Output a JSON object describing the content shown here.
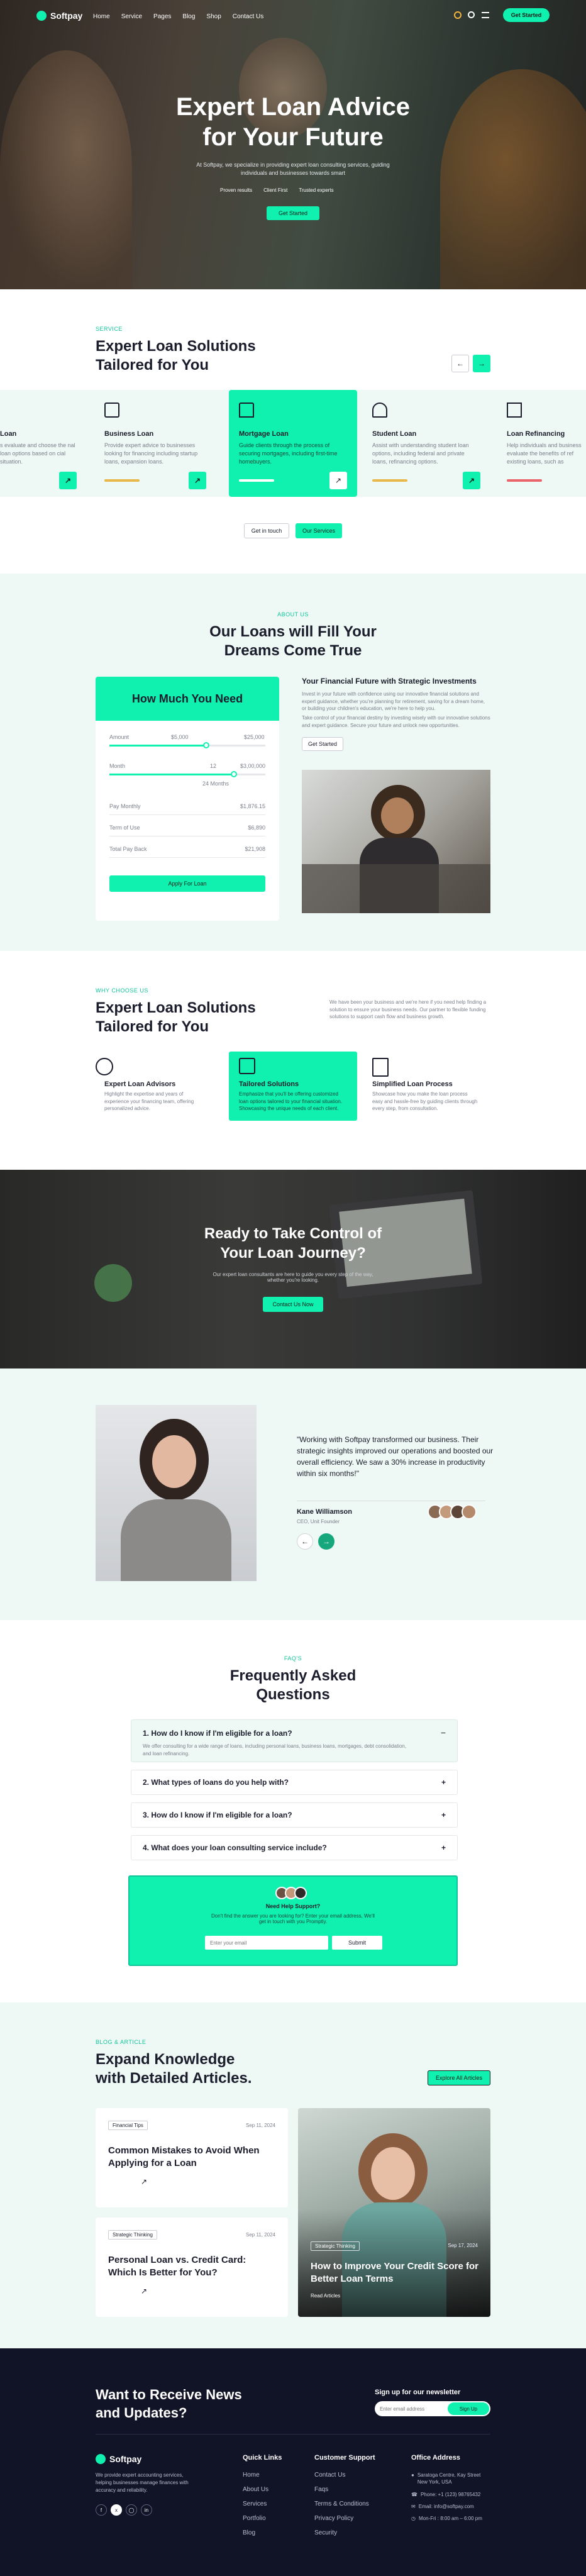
{
  "nav": {
    "brand": "Softpay",
    "items": [
      "Home",
      "Service",
      "Pages",
      "Blog",
      "Shop",
      "Contact Us"
    ],
    "cta": "Get Started"
  },
  "hero": {
    "title_line1": "Expert Loan Advice",
    "title_line2": "for Your Future",
    "subtitle": "At Softpay, we specialize in providing expert loan consulting services, guiding individuals and businesses towards smart",
    "badges": [
      "Proven results",
      "Client First",
      "Trusted experts"
    ],
    "cta": "Get Started"
  },
  "services": {
    "eyebrow": "SERVICE",
    "title_line1": "Expert Loan Solutions",
    "title_line2": "Tailored for You",
    "cards": [
      {
        "title": "Loan",
        "desc": "s evaluate and choose the nal loan options based on cial situation.",
        "variant": "partial-left"
      },
      {
        "title": "Business Loan",
        "desc": "Provide expert advice to businesses looking for financing including startup loans, expansion loans.",
        "variant": "normal"
      },
      {
        "title": "Mortgage Loan",
        "desc": "Guide clients through the process of securing mortgages, including first-time homebuyers.",
        "variant": "active"
      },
      {
        "title": "Student Loan",
        "desc": "Assist with understanding student loan options, including federal and private loans, refinancing options.",
        "variant": "normal"
      },
      {
        "title": "Loan Refinancing",
        "desc": "Help individuals and business evaluate the benefits of ref existing loans, such as",
        "variant": "partial-right"
      }
    ],
    "btn_touch": "Get in touch",
    "btn_services": "Our Services"
  },
  "calculator": {
    "eyebrow": "ABOUT US",
    "title_line1": "Our Loans will Fill Your",
    "title_line2": "Dreams Come True",
    "panel_title": "How Much You Need",
    "amount_label": "Amount",
    "amount_min": "$5,000",
    "amount_max": "$25,000",
    "amount_mid": "$3,00,000",
    "months_label": "Month",
    "months_min": "12",
    "months_max": "24 Months",
    "rows": [
      {
        "label": "Pay Monthly",
        "value": "$1,876.15"
      },
      {
        "label": "Term of Use",
        "value": "$6,890"
      },
      {
        "label": "Total Pay Back",
        "value": "$21,908"
      }
    ],
    "apply": "Apply For Loan",
    "right_title": "Your Financial Future with Strategic Investments",
    "right_text1": "Invest in your future with confidence using our innovative financial solutions and expert guidance, whether you're planning for retirement, saving for a dream home, or building your children's education, we're here to help you.",
    "right_text2": "Take control of your financial destiny by investing wisely with our innovative solutions and expert guidance. Secure your future and unlock new opportunities.",
    "right_cta": "Get Started"
  },
  "why": {
    "eyebrow": "WHY CHOOSE US",
    "title_line1": "Expert Loan Solutions",
    "title_line2": "Tailored for You",
    "desc": "We have been your business and we're here if you need help finding a solution to ensure your business needs. Our partner to flexible funding solutions to support cash flow and business growth.",
    "features": [
      {
        "title": "Expert Loan Advisors",
        "desc": "Highlight the expertise and years of experience your financing team, offering personalized advice.",
        "active": false
      },
      {
        "title": "Tailored Solutions",
        "desc": "Emphasize that you'll be offering customized loan options tailored to your financial situation. Showcasing the unique needs of each client.",
        "active": true
      },
      {
        "title": "Simplified Loan Process",
        "desc": "Showcase how you make the loan process easy and hassle-free by guiding clients through every step, from consultation.",
        "active": false
      }
    ]
  },
  "cta_banner": {
    "title_line1": "Ready to Take Control of",
    "title_line2": "Your Loan Journey?",
    "desc": "Our expert loan consultants are here to guide you every step of the way, whether you're looking.",
    "button": "Contact Us Now"
  },
  "testimonial": {
    "quote": "\"Working with Softpay transformed our business. Their strategic insights improved our operations and boosted our overall efficiency. We saw a 30% increase in productivity within six months!\"",
    "name": "Kane Williamson",
    "role": "CEO, Unit Founder"
  },
  "faq": {
    "eyebrow": "FAQ'S",
    "title_line1": "Frequently Asked",
    "title_line2": "Questions",
    "items": [
      {
        "q": "1. How do I know if I'm eligible for a loan?",
        "a": "We offer consulting for a wide range of loans, including personal loans, business loans, mortgages, debt consolidation, and loan refinancing.",
        "open": true
      },
      {
        "q": "2. What types of loans do you help with?",
        "a": "",
        "open": false
      },
      {
        "q": "3. How do I know if I'm eligible for a loan?",
        "a": "",
        "open": false
      },
      {
        "q": "4. What does your loan consulting service include?",
        "a": "",
        "open": false
      }
    ],
    "box_label": "Need Help Support?",
    "box_text": "Don't find the answer you are looking for? Enter your email address, We'll get in touch with you Promptly.",
    "email_placeholder": "Enter your email",
    "submit": "Submit"
  },
  "blog": {
    "eyebrow": "BLOG & ARTICLE",
    "title_line1": "Expand Knowledge",
    "title_line2": "with Detailed Articles.",
    "cta": "Explore All Articles",
    "posts": [
      {
        "tag": "Financial Tips",
        "date": "Sep 11, 2024",
        "title": "Common Mistakes to Avoid When Applying for a Loan"
      },
      {
        "tag": "Strategic Thinking",
        "date": "Sep 11, 2024",
        "title": "Personal Loan vs. Credit Card: Which Is Better for You?"
      },
      {
        "tag": "Strategic Thinking",
        "date": "Sep 17, 2024",
        "title": "How to Improve Your Credit Score for Better Loan Terms",
        "read": "Read Articles"
      }
    ]
  },
  "footer": {
    "news_title_line1": "Want to Receive News",
    "news_title_line2": "and Updates?",
    "signup_label": "Sign up for our newsletter",
    "email_placeholder": "Enter email address",
    "signup_button": "Sign Up",
    "brand": "Softpay",
    "about": "We provide expert accounting services, helping businesses manage finances with accuracy and reliability.",
    "quick_title": "Quick Links",
    "quick": [
      "Home",
      "About Us",
      "Services",
      "Portfolio",
      "Blog"
    ],
    "support_title": "Customer Support",
    "support": [
      "Contact Us",
      "Faqs",
      "Terms & Conditions",
      "Privacy Policy",
      "Security"
    ],
    "office_title": "Office Address",
    "office": [
      "Saratoga Centre, Kay Street New York, USA",
      "Phone: +1 (123) 98765432",
      "Email: info@softpay.com",
      "Mon-Fri : 8:00 am – 6:00 pm"
    ]
  }
}
